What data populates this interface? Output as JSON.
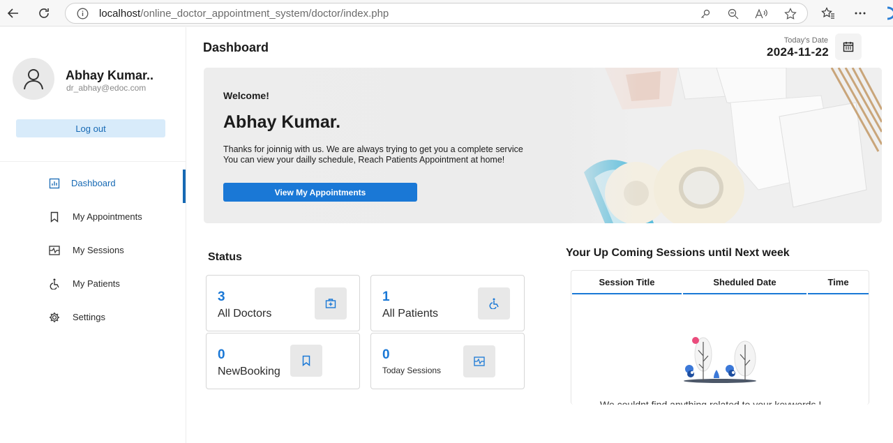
{
  "browser": {
    "url_host": "localhost",
    "url_path": "/online_doctor_appointment_system/doctor/index.php"
  },
  "profile": {
    "name": "Abhay Kumar..",
    "email": "dr_abhay@edoc.com",
    "logout_label": "Log out"
  },
  "menu": [
    {
      "label": "Dashboard",
      "icon": "dashboard-icon",
      "active": true
    },
    {
      "label": "My Appointments",
      "icon": "bookmark-icon",
      "active": false
    },
    {
      "label": "My Sessions",
      "icon": "sessions-icon",
      "active": false
    },
    {
      "label": "My Patients",
      "icon": "wheelchair-icon",
      "active": false
    },
    {
      "label": "Settings",
      "icon": "gear-icon",
      "active": false
    }
  ],
  "header": {
    "title": "Dashboard",
    "date_label": "Today's Date",
    "date_value": "2024-11-22"
  },
  "banner": {
    "welcome": "Welcome!",
    "doctor_name": "Abhay Kumar.",
    "message_line1": "Thanks for joinnig with us. We are always trying to get you a complete service",
    "message_line2": "You can view your dailly schedule, Reach Patients Appointment at home!",
    "cta_label": "View My Appointments"
  },
  "status": {
    "title": "Status",
    "cards": [
      {
        "value": "3",
        "label": "All Doctors",
        "icon": "doctor-bag-icon"
      },
      {
        "value": "1",
        "label": "All Patients",
        "icon": "wheelchair-icon"
      },
      {
        "value": "0",
        "label": "NewBooking",
        "icon": "bookmark-icon"
      },
      {
        "value": "0",
        "label": "Today Sessions",
        "icon": "sessions-icon"
      }
    ]
  },
  "sessions": {
    "title": "Your Up Coming Sessions until Next week",
    "columns": [
      "Session Title",
      "Sheduled Date",
      "Time"
    ],
    "empty_message": "We  couldnt find anything related to your keywords !"
  },
  "colors": {
    "accent": "#1a78d6",
    "accent_light": "#d8ebfa"
  }
}
